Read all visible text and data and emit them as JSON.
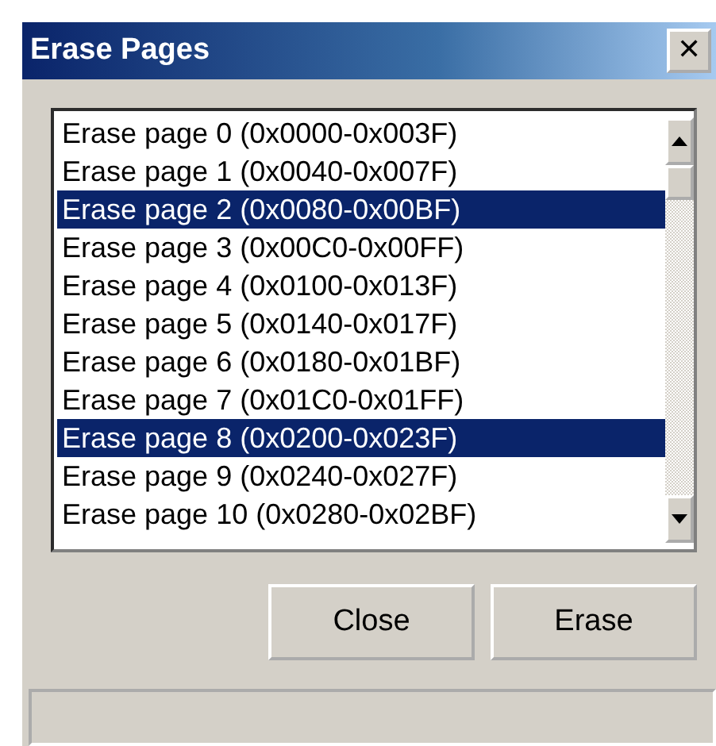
{
  "window": {
    "title": "Erase Pages",
    "close": "✕"
  },
  "pages": [
    {
      "label": "Erase page 0 (0x0000-0x003F)",
      "selected": false
    },
    {
      "label": "Erase page 1 (0x0040-0x007F)",
      "selected": false
    },
    {
      "label": "Erase page 2 (0x0080-0x00BF)",
      "selected": true
    },
    {
      "label": "Erase page 3 (0x00C0-0x00FF)",
      "selected": false
    },
    {
      "label": "Erase page 4 (0x0100-0x013F)",
      "selected": false
    },
    {
      "label": "Erase page 5 (0x0140-0x017F)",
      "selected": false
    },
    {
      "label": "Erase page 6 (0x0180-0x01BF)",
      "selected": false
    },
    {
      "label": "Erase page 7 (0x01C0-0x01FF)",
      "selected": false
    },
    {
      "label": "Erase page 8 (0x0200-0x023F)",
      "selected": true
    },
    {
      "label": "Erase page 9 (0x0240-0x027F)",
      "selected": false
    },
    {
      "label": "Erase page 10 (0x0280-0x02BF)",
      "selected": false
    }
  ],
  "buttons": [
    "Close",
    "Erase"
  ]
}
